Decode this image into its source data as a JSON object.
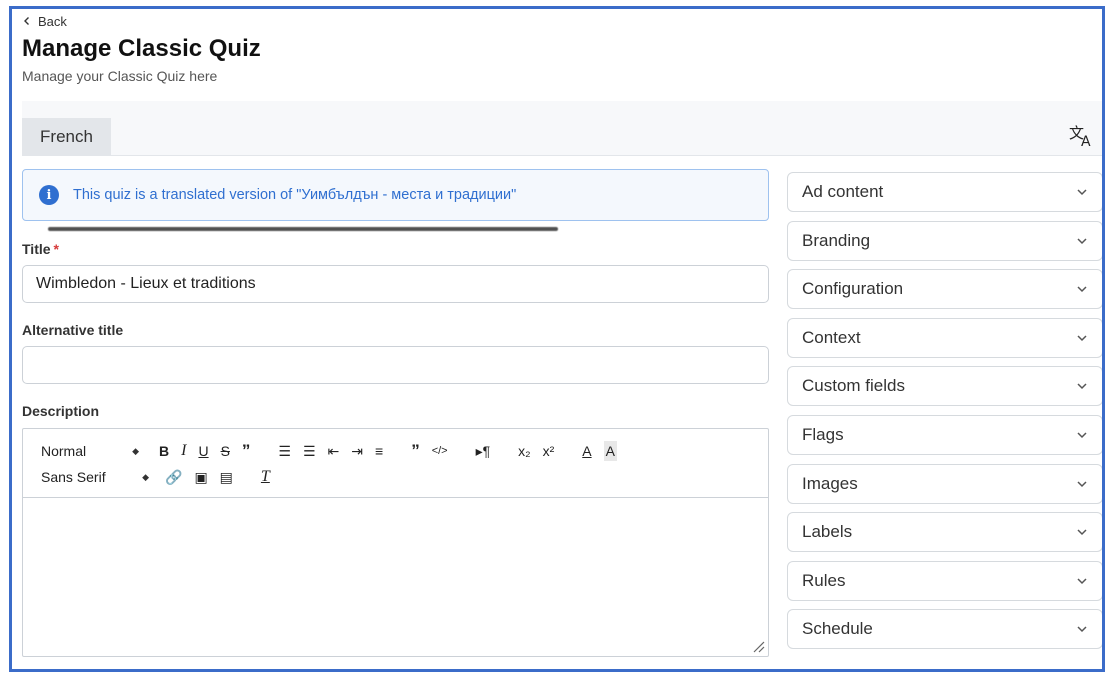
{
  "header": {
    "back_label": "Back",
    "title": "Manage Classic Quiz",
    "subtitle": "Manage your Classic Quiz here"
  },
  "tabs": [
    {
      "label": "French",
      "active": true
    }
  ],
  "info": {
    "message": "This quiz is a translated version of \"Уимбълдън - места и традиции\""
  },
  "form": {
    "title_label": "Title",
    "title_required_mark": "*",
    "title_value": "Wimbledon - Lieux et traditions",
    "alt_title_label": "Alternative title",
    "alt_title_value": "",
    "description_label": "Description",
    "editor": {
      "format_select": "Normal",
      "font_select": "Sans Serif"
    }
  },
  "accordion": [
    {
      "label": "Ad content"
    },
    {
      "label": "Branding"
    },
    {
      "label": "Configuration"
    },
    {
      "label": "Context"
    },
    {
      "label": "Custom fields"
    },
    {
      "label": "Flags"
    },
    {
      "label": "Images"
    },
    {
      "label": "Labels"
    },
    {
      "label": "Rules"
    },
    {
      "label": "Schedule"
    }
  ],
  "colors": {
    "accent": "#2f6fd0",
    "frame": "#3b6cc9",
    "required": "#d63a3a",
    "info_border": "#9ec2ef"
  }
}
